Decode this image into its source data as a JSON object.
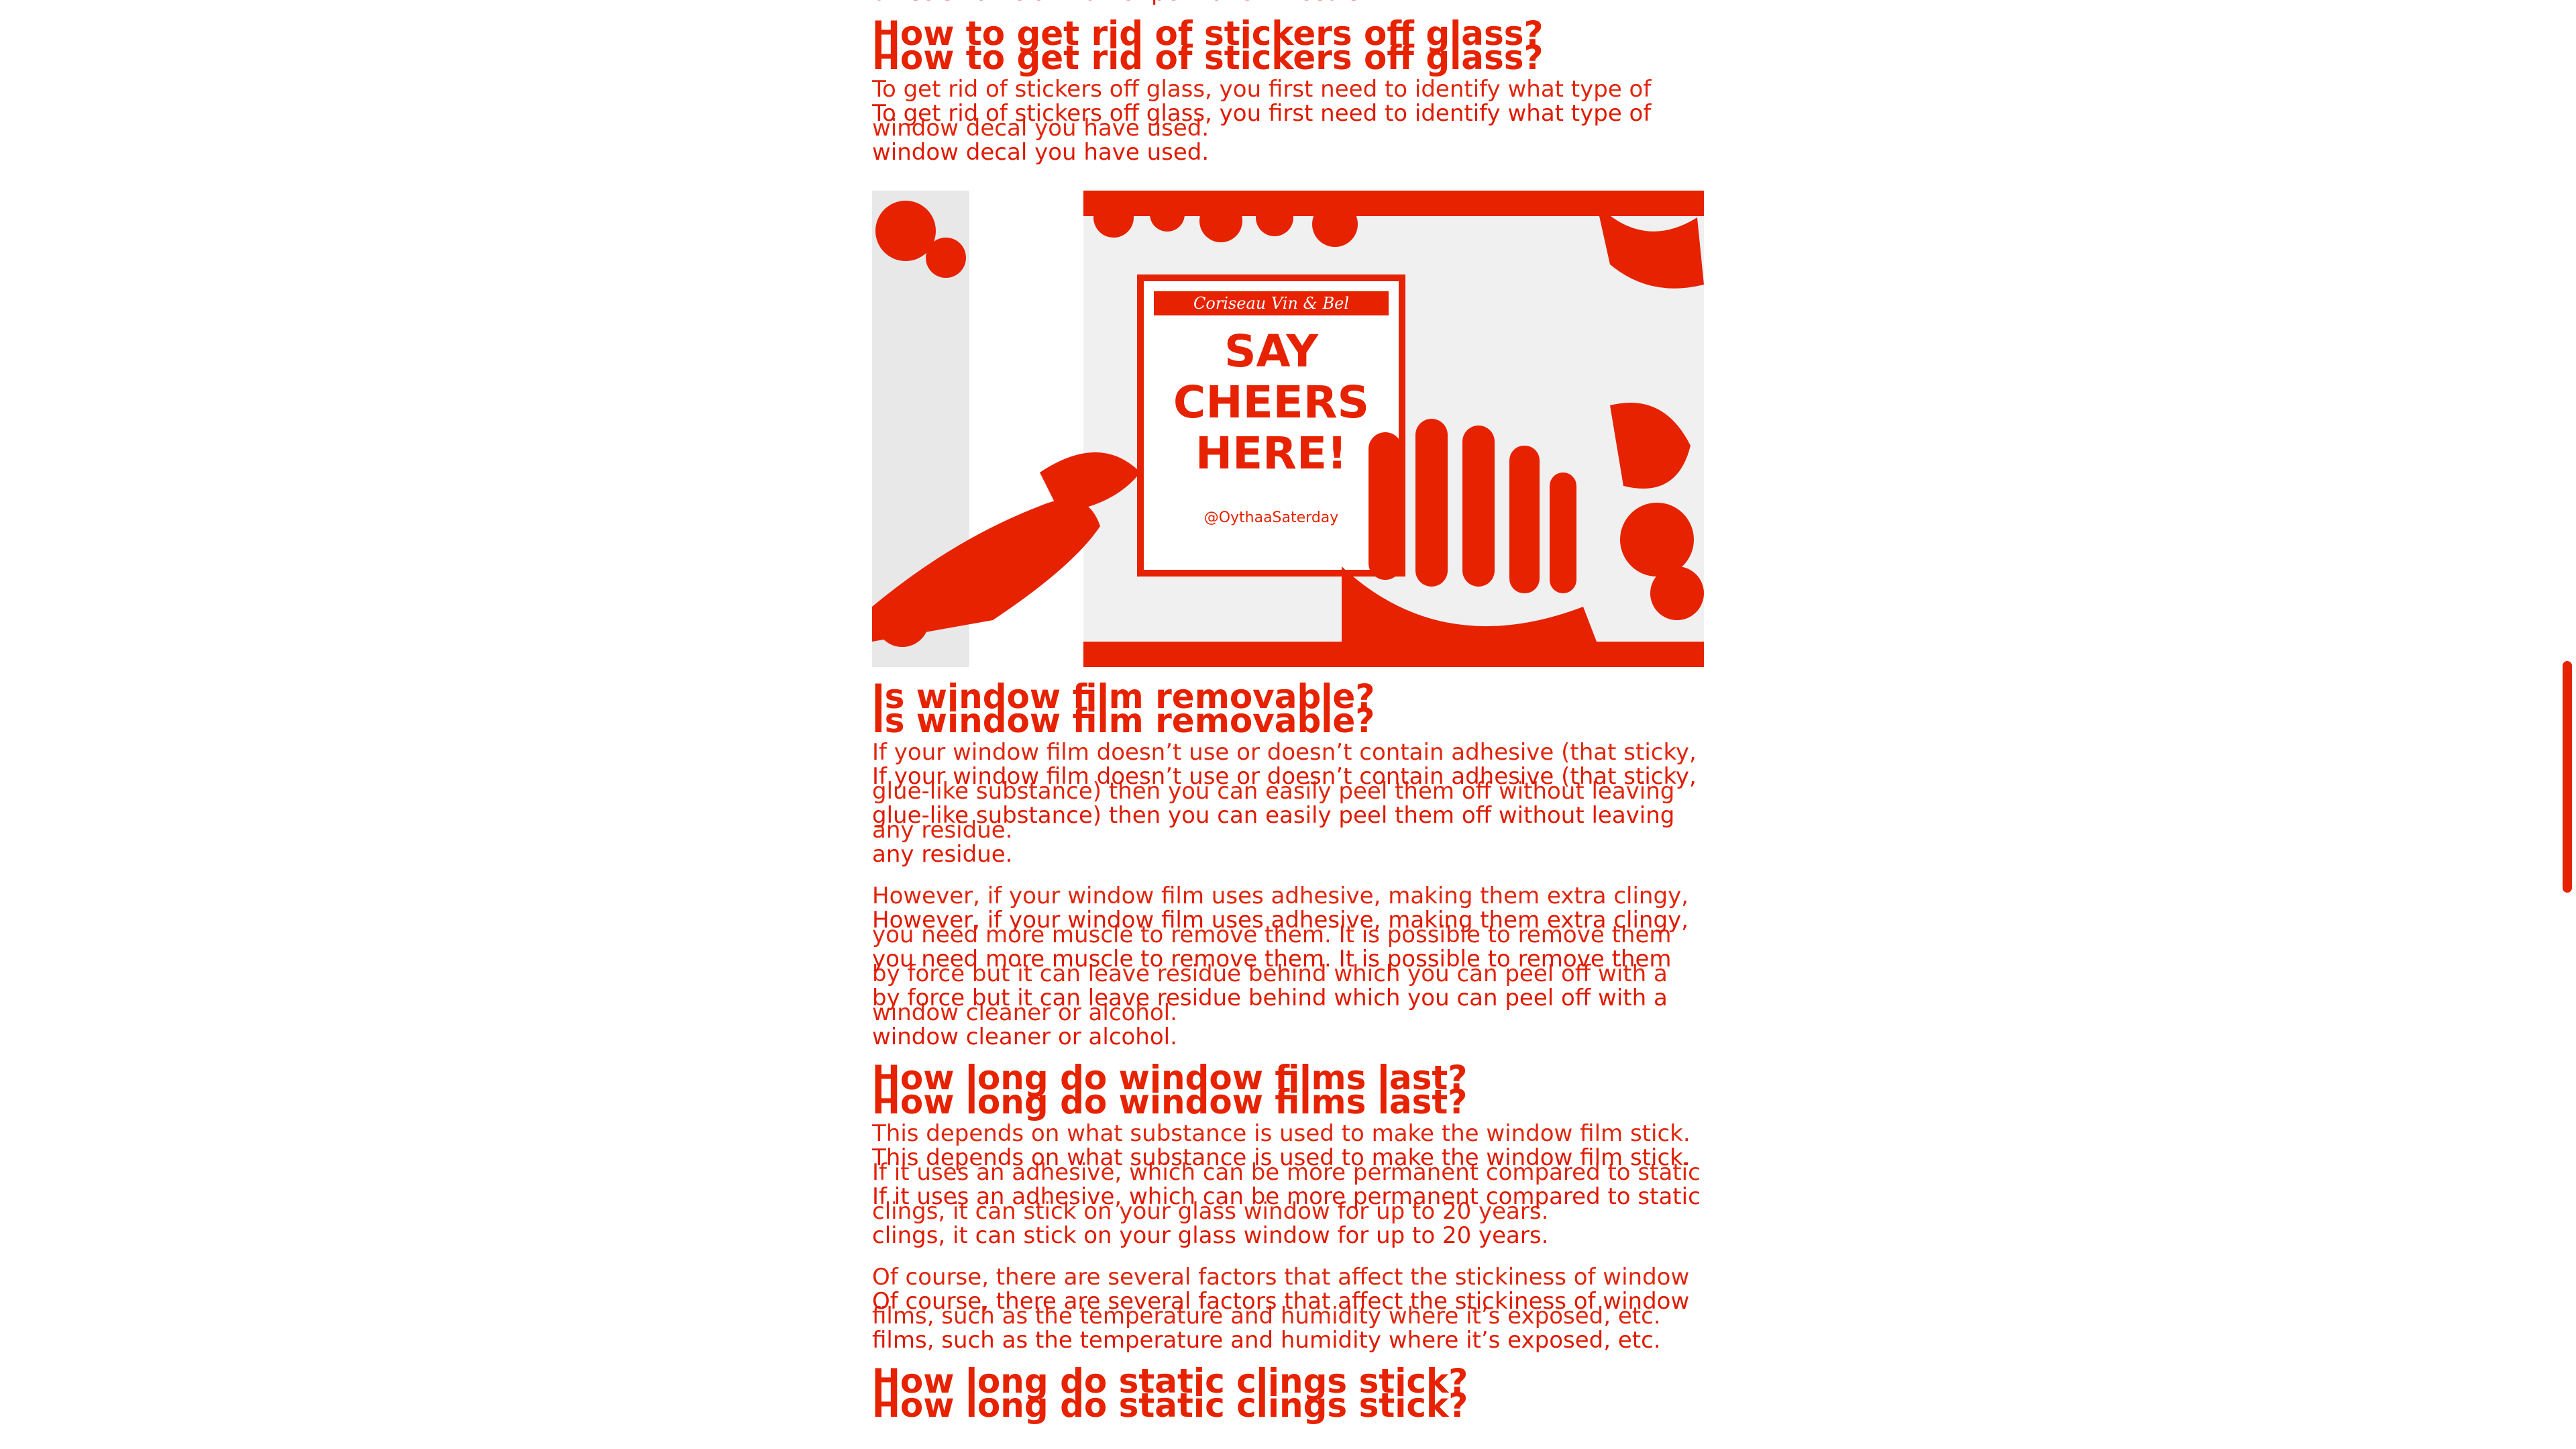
{
  "article": {
    "intro_tail": "office’s name and other permanent decors.",
    "section1": {
      "heading": "How to get rid of stickers off glass?",
      "paragraph": "To get rid of stickers off glass, you first need to identify what type of window decal you have used."
    },
    "image": {
      "sticker_text": "SAY CHEERS HERE!",
      "sticker_top": "Coriseau Vin & Bel",
      "sticker_handle": "@OythaaSaterday"
    },
    "section2": {
      "heading": "Is window film removable?",
      "paragraph1": "If your window film doesn’t use or doesn’t contain adhesive (that sticky, glue-like substance) then you can easily peel them off without leaving any residue.",
      "paragraph2": "However, if your window film uses adhesive, making them extra clingy, you need more muscle to remove them. It is possible to remove them by force but it can leave residue behind which you can peel off with a window cleaner or alcohol."
    },
    "section3": {
      "heading": "How long do window films last?",
      "paragraph1": "This depends on what substance is used to make the window film stick. If it uses an adhesive, which can be more permanent compared to static clings, it can stick on your glass window for up to 20 years.",
      "paragraph2": "Of course, there are several factors that affect the stickiness of window films, such as the temperature and humidity where it’s exposed, etc."
    },
    "section4": {
      "heading": "How long do static clings stick?"
    }
  },
  "colors": {
    "text": "#e01a00",
    "heading": "#e62200",
    "background": "#ffffff"
  }
}
